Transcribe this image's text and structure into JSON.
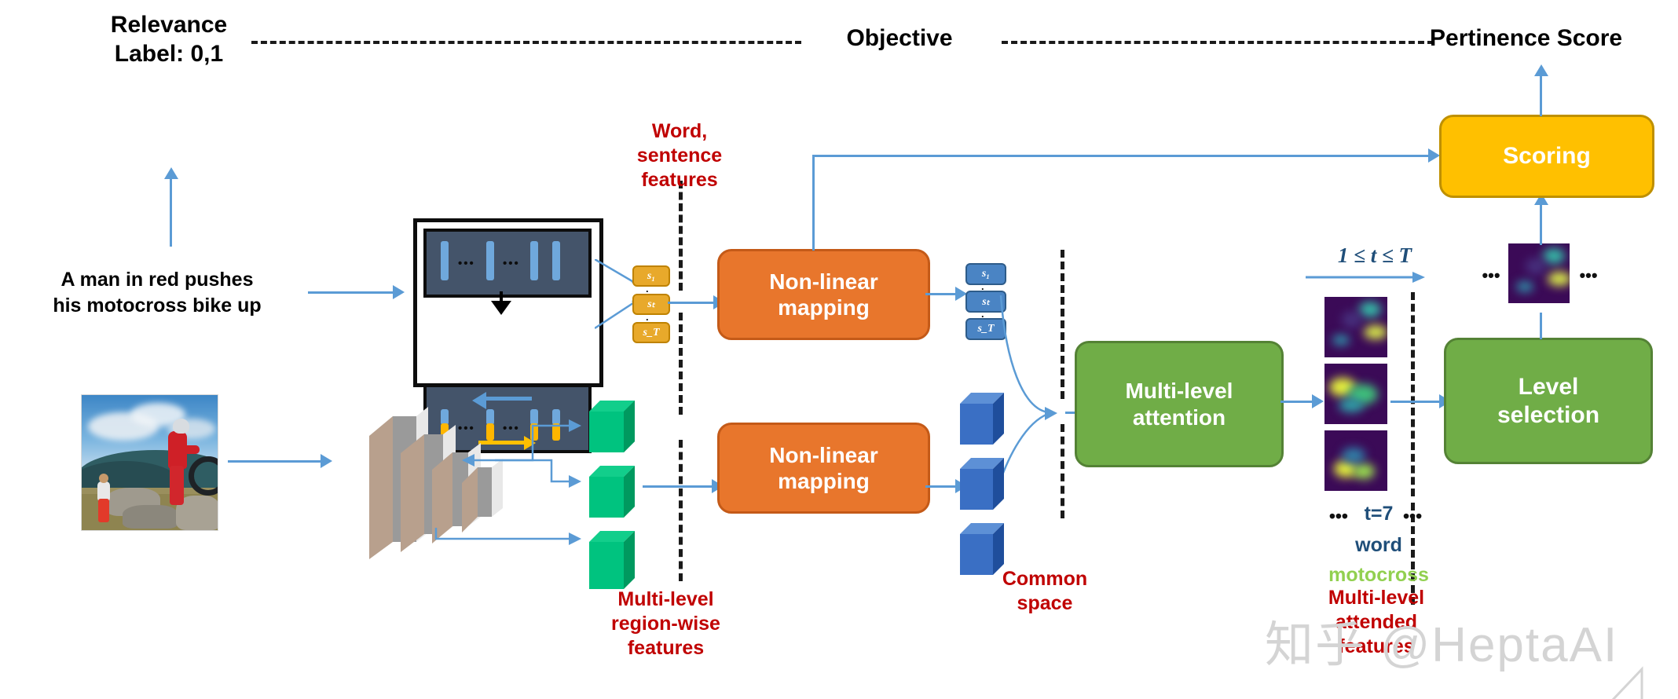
{
  "headers": {
    "relevance_line1": "Relevance",
    "relevance_line2": "Label: 0,1",
    "objective": "Objective",
    "pertinence": "Pertinence Score"
  },
  "input": {
    "caption_line1": "A man in red pushes",
    "caption_line2": "his motocross bike up",
    "image_alt": "motocross rider photo"
  },
  "labels": {
    "word_sentence_features": "Word,\nsentence\nfeatures",
    "word_sentence_l1": "Word,",
    "word_sentence_l2": "sentence",
    "word_sentence_l3": "features",
    "region_features_l1": "Multi-level",
    "region_features_l2": "region-wise",
    "region_features_l3": "features",
    "common_space_l1": "Common",
    "common_space_l2": "space",
    "attended_l1": "Multi-level",
    "attended_l2": "attended",
    "attended_l3": "features",
    "range_annotation": "1 ≤ t ≤ T",
    "t_index": "t=7",
    "word_label": "word",
    "word_value": "motocross",
    "dots_left": "•••",
    "dots_right": "•••"
  },
  "boxes": {
    "nonlinear_text_l1": "Non-linear",
    "nonlinear_text_l2": "mapping",
    "nonlinear_img_l1": "Non-linear",
    "nonlinear_img_l2": "mapping",
    "attention_l1": "Multi-level",
    "attention_l2": "attention",
    "level_selection_l1": "Level",
    "level_selection_l2": "selection",
    "scoring": "Scoring"
  },
  "tokens": {
    "sentence_chips": [
      "s₁",
      "sₜ",
      "s_T"
    ],
    "sentence_chips_sub": [
      "1",
      "t",
      "T"
    ],
    "common_chips": [
      "s₁",
      "sₜ",
      "s_T"
    ],
    "dots": "⋮"
  },
  "colors": {
    "orange": "#E8762C",
    "green": "#70AD47",
    "yellow": "#FFC000",
    "arrow_blue": "#5B9BD5",
    "red_text": "#C00000",
    "dark_blue_text": "#1F4E79",
    "green_word": "#92D050",
    "lstm_panel": "#44546A",
    "chip_yellow": "#E8A92B",
    "chip_blue": "#4A84C4",
    "feature_green": "#00B274",
    "feature_blue": "#3A6FC4"
  },
  "watermark": {
    "text": "知乎 @HeptaAI"
  }
}
